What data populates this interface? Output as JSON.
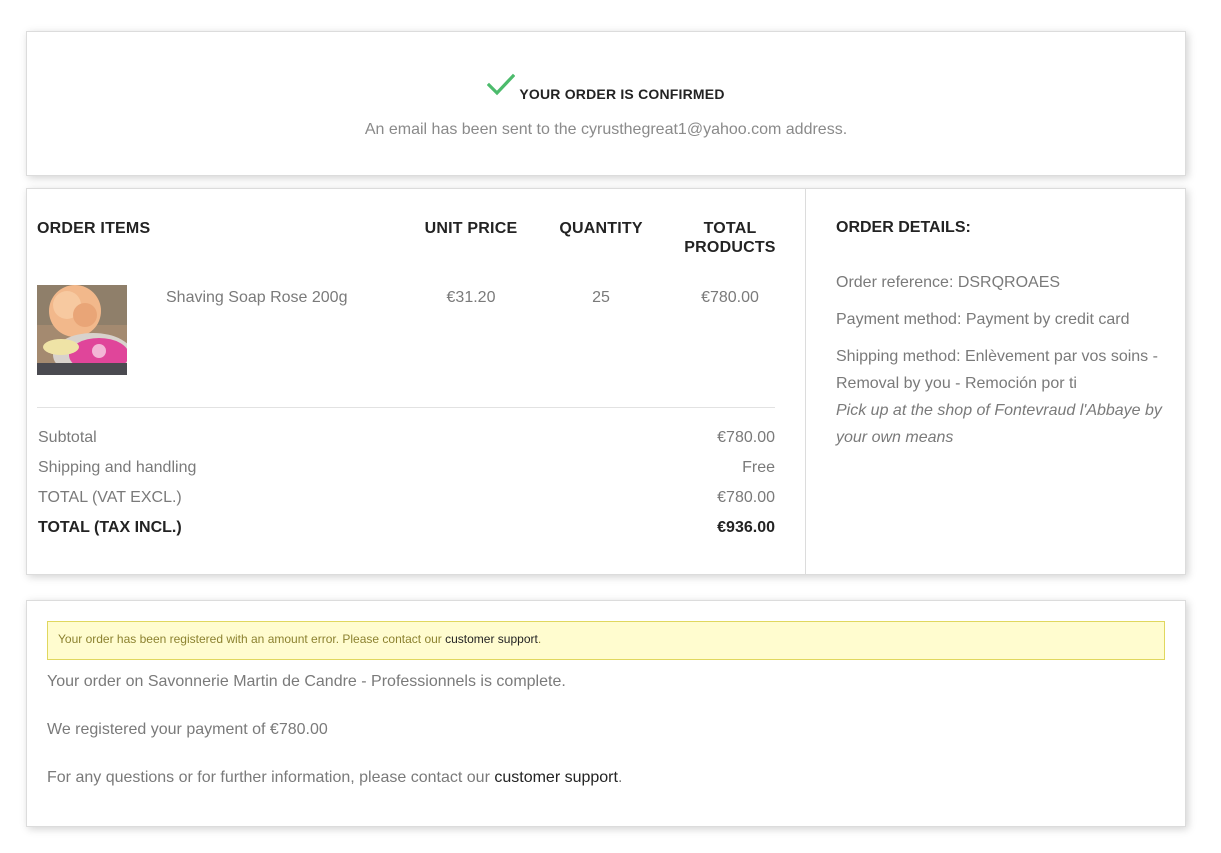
{
  "confirmation": {
    "title": "YOUR ORDER IS CONFIRMED",
    "email_text": "An email has been sent to the cyrusthegreat1@yahoo.com address.",
    "check_color": "#4cbb6c"
  },
  "order_items": {
    "headers": {
      "items": "ORDER ITEMS",
      "unit_price": "UNIT PRICE",
      "quantity": "QUANTITY",
      "total_products_line1": "TOTAL",
      "total_products_line2": "PRODUCTS"
    },
    "item": {
      "name": "Shaving Soap Rose 200g",
      "unit_price": "€31.20",
      "quantity": "25",
      "total": "€780.00"
    },
    "summary": [
      {
        "label": "Subtotal",
        "value": "€780.00"
      },
      {
        "label": "Shipping and handling",
        "value": "Free"
      },
      {
        "label": "TOTAL (VAT EXCL.)",
        "value": "€780.00"
      },
      {
        "label": "TOTAL (TAX INCL.)",
        "value": "€936.00"
      }
    ]
  },
  "order_details": {
    "title": "ORDER DETAILS:",
    "reference": "Order reference: DSRQROAES",
    "payment": "Payment method: Payment by credit card",
    "shipping": "Shipping method: Enlèvement par vos soins - Removal by you - Remoción por ti",
    "shipping_note": "Pick up at the shop of Fontevraud l'Abbaye by your own means"
  },
  "footer": {
    "alert_text": "Your order has been registered with an amount error. Please contact our ",
    "alert_link": "customer support",
    "alert_end": ".",
    "complete_text": "Your order on Savonnerie Martin de Candre - Professionnels is complete.",
    "payment_text": "We registered your payment of  €780.00",
    "questions_text": "For any questions or for further information, please contact our ",
    "questions_link": "customer support",
    "questions_end": "."
  }
}
